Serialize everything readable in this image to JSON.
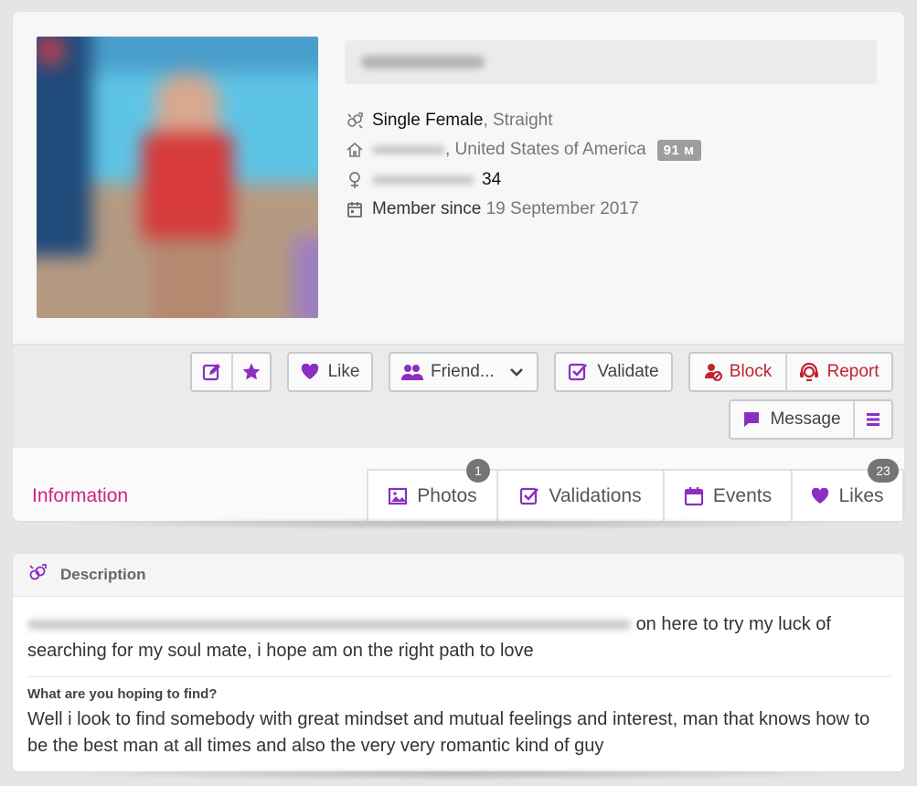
{
  "profile": {
    "name_blurred": "████████",
    "status": "Single Female",
    "orientation": ", Straight",
    "location_country": ", United States of America",
    "distance_badge": "91 м",
    "age": "34",
    "member_label": "Member since",
    "member_date": "19 September 2017"
  },
  "actions": {
    "like": "Like",
    "friend": "Friend...",
    "validate": "Validate",
    "block": "Block",
    "report": "Report",
    "message": "Message"
  },
  "tabs": {
    "information": "Information",
    "photos": "Photos",
    "photos_count": "1",
    "validations": "Validations",
    "events": "Events",
    "likes": "Likes",
    "likes_count": "23"
  },
  "description": {
    "title": "Description",
    "text_visible": "on here to try my luck of searching for my soul mate, i hope am on the right path to love",
    "question": "What are you hoping to find?",
    "answer": "Well i look to find somebody with great mindset and mutual feelings and interest, man that knows how to be the best man at all times and also the very very romantic kind of guy"
  },
  "colors": {
    "accent_purple": "#8a2fc2",
    "accent_pink": "#d0237f",
    "danger_red": "#c0242e",
    "badge_gray": "#757575"
  },
  "icons": {
    "gender": "couple-icon",
    "home": "home-icon",
    "female": "female-icon",
    "calendar": "calendar-icon"
  }
}
